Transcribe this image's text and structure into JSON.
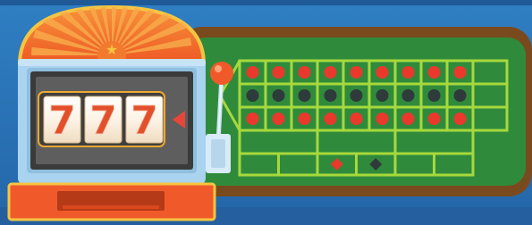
{
  "scene": {
    "background": "#2a6fb3",
    "table_felt": "#2f8a3a",
    "table_border": "#7b4a1e",
    "grid_lines": "#a7d83c",
    "machine_body": "#a9d4f0",
    "machine_top": "#f47a2c",
    "machine_base": "#f05a2a",
    "lever_ball": "#f05a2a"
  },
  "reels": {
    "symbols": [
      "7",
      "7",
      "7"
    ],
    "pointer": "◀"
  },
  "roulette_table": {
    "number_rows": [
      [
        "red",
        "red",
        "red",
        "red",
        "red",
        "red",
        "red",
        "red",
        "red"
      ],
      [
        "black",
        "black",
        "black",
        "black",
        "black",
        "black",
        "black",
        "black",
        "black"
      ],
      [
        "red",
        "red",
        "red",
        "red",
        "red",
        "red",
        "red",
        "red",
        "red"
      ]
    ],
    "outside_bets": [
      "red-diamond",
      "black-diamond"
    ],
    "colors": {
      "red": "#e8392c",
      "black": "#2f3a3a"
    }
  }
}
